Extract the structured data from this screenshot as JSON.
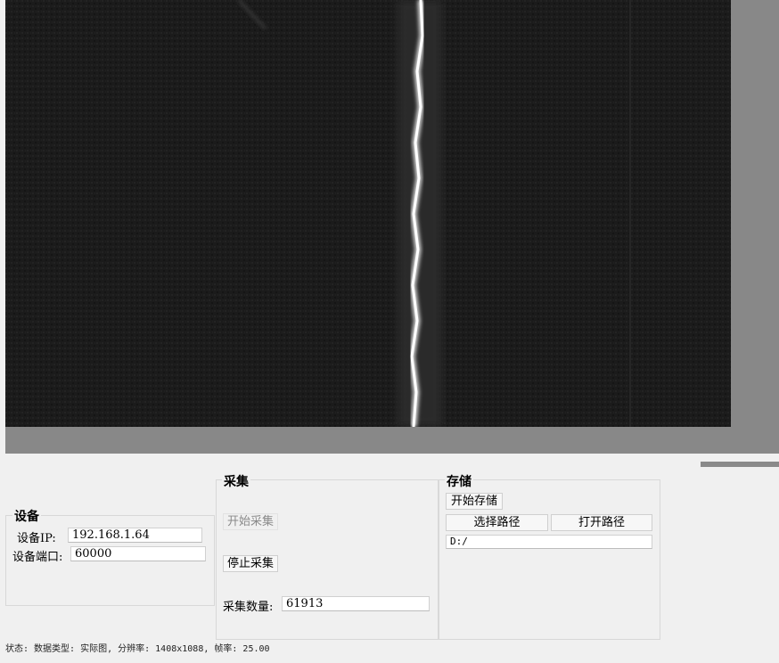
{
  "device": {
    "title": "设备",
    "ip_label": "设备IP:",
    "ip_value": "192.168.1.64",
    "port_label": "设备端口:",
    "port_value": "60000"
  },
  "capture": {
    "title": "采集",
    "start_label": "开始采集",
    "stop_label": "停止采集",
    "count_label": "采集数量:",
    "count_value": "61913"
  },
  "storage": {
    "title": "存储",
    "start_label": "开始存储",
    "choose_path_label": "选择路径",
    "open_path_label": "打开路径",
    "path_value": "D:/"
  },
  "status_bar": {
    "text": "状态: 数据类型: 实际图, 分辨率: 1408x1088, 帧率: 25.00"
  },
  "colors": {
    "image_background": "#1b1b1b",
    "viewport_background": "#888888",
    "panel_background": "#f0f0f0"
  }
}
